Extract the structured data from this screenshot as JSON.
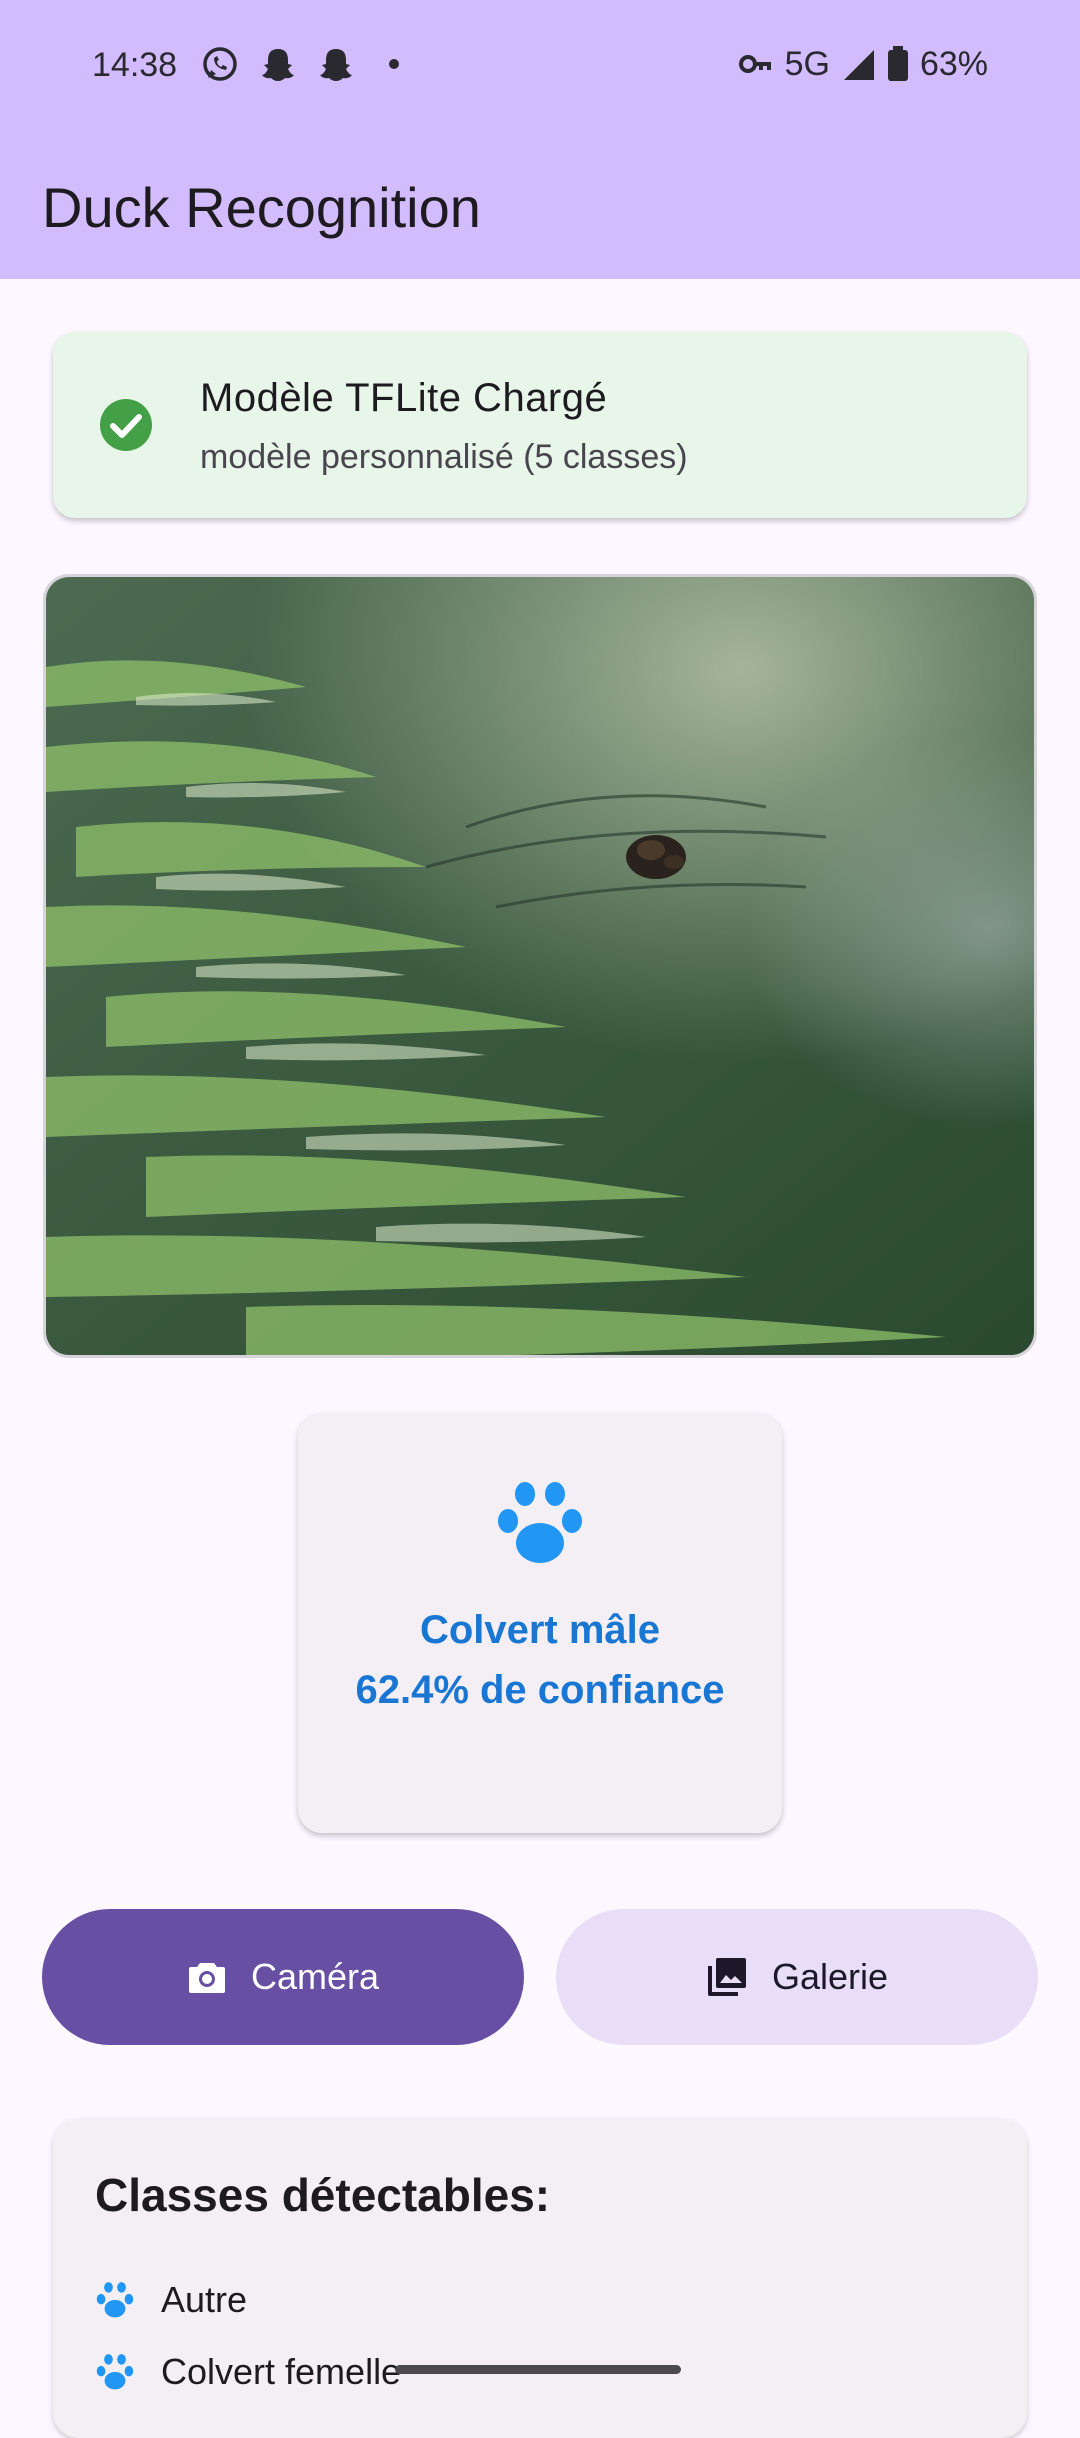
{
  "status_bar": {
    "time": "14:38",
    "network": "5G",
    "battery": "63%",
    "left_icons": [
      "whatsapp-icon",
      "snapchat-icon",
      "snapchat-icon",
      "dot-icon"
    ],
    "right_icons": [
      "key-icon",
      "signal-icon",
      "battery-icon"
    ]
  },
  "app_bar": {
    "title": "Duck Recognition"
  },
  "model_status": {
    "title": "Modèle TFLite Chargé",
    "subtitle": "modèle personnalisé (5 classes)",
    "icon": "check-circle-icon",
    "color": "#43a047"
  },
  "result": {
    "icon": "paw-icon",
    "label": "Colvert mâle",
    "confidence_text": "62.4% de confiance",
    "confidence": 0.624,
    "color": "#1976d2"
  },
  "buttons": {
    "camera_label": "Caméra",
    "camera_icon": "camera-icon",
    "gallery_label": "Galerie",
    "gallery_icon": "gallery-icon"
  },
  "classes": {
    "title": "Classes détectables:",
    "items": [
      {
        "label": "Autre",
        "icon": "paw-icon"
      },
      {
        "label": "Colvert femelle",
        "icon": "paw-icon"
      }
    ]
  },
  "colors": {
    "app_bar": "#d2bcfe",
    "primary": "#6750a4",
    "secondary_container": "#e8def8",
    "accent_blue": "#1976d2",
    "success_bg": "#e8f5e9"
  }
}
